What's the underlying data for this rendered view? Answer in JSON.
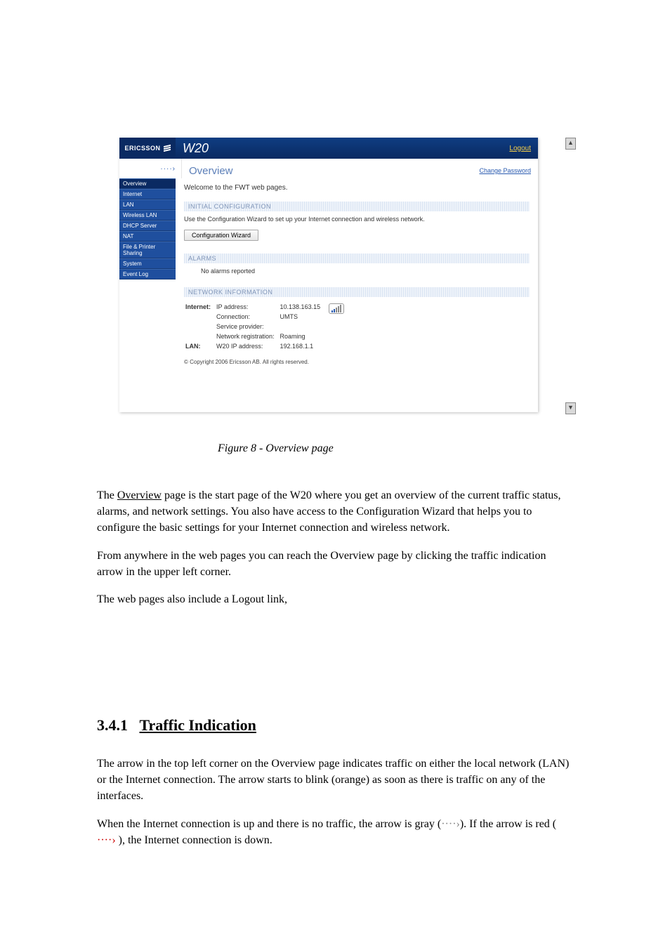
{
  "brand": "ERICSSON",
  "product": "W20",
  "logout": "Logout",
  "page_title": "Overview",
  "change_password": "Change Password",
  "traffic_icon": "····›",
  "nav": {
    "items": [
      "Overview",
      "Internet",
      "LAN",
      "Wireless LAN",
      "DHCP Server",
      "NAT",
      "File & Printer Sharing",
      "System",
      "Event Log"
    ]
  },
  "welcome": "Welcome to the FWT web pages.",
  "sec1": {
    "title": "INITIAL CONFIGURATION",
    "desc": "Use the Configuration Wizard to set up your Internet connection and wireless network.",
    "button": "Configuration Wizard"
  },
  "sec2": {
    "title": "ALARMS",
    "msg": "No alarms reported"
  },
  "sec3": {
    "title": "NETWORK INFORMATION",
    "internet_label": "Internet:",
    "ip_label": "IP address:",
    "ip_value": "10.138.163.15",
    "conn_label": "Connection:",
    "conn_value": "UMTS",
    "sp_label": "Service provider:",
    "sp_value": "",
    "nr_label": "Network registration:",
    "nr_value": "Roaming",
    "lan_label": "LAN:",
    "lan_ip_label": "W20 IP address:",
    "lan_ip_value": "192.168.1.1"
  },
  "copyright": "© Copyright 2006 Ericsson AB. All rights reserved.",
  "scroll_up": "▲",
  "scroll_down": "▼",
  "doc": {
    "caption": "Figure 8 - Overview page",
    "p1a": "The ",
    "p1b": "Overview",
    "p1c": " page is the start page of the W20 where you get an overview of the current traffic status, alarms, and network settings. You also have access to the Configuration Wizard that helps you to configure the basic settings for your Internet connection and wireless network.",
    "p2": "From anywhere in the web pages you can reach the Overview page by clicking the traffic indication arrow in the upper left corner.",
    "p3": "The web pages also include a Logout link, ",
    "h3_num": "3.4.1",
    "h3_txt": "Traffic Indication",
    "p4a": "The arrow in the top left corner on the ",
    "p4b": "Overview",
    "p4c": " page indicates traffic on either the local network (LAN) or the Internet connection. The arrow starts to blink (orange) as soon as there is traffic on any of the interfaces.",
    "p5a": "When the Internet connection is up and there is no traffic, the arrow is gray (",
    "p5c": "). If the arrow is red ( ",
    "p5e": " ), the Internet connection is down."
  }
}
